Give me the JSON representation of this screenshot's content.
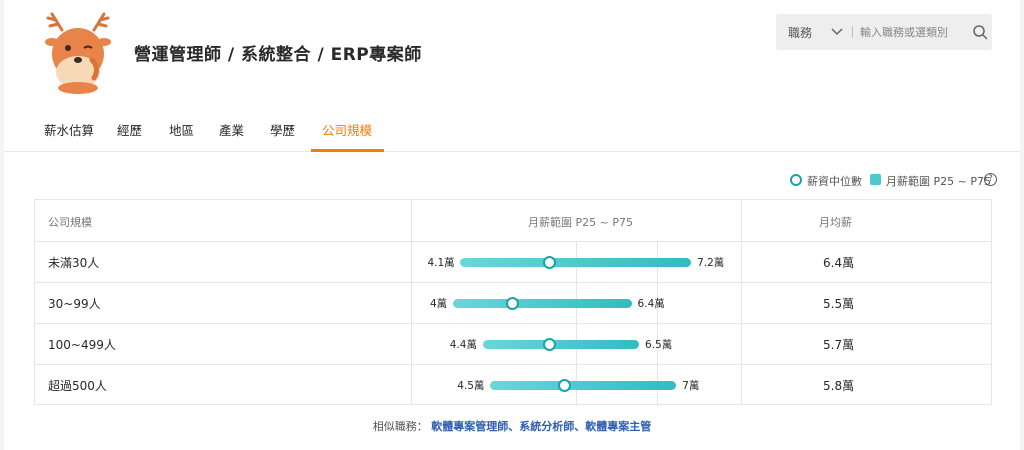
{
  "header": {
    "title": "營運管理師 / 系統整合 / ERP專案師"
  },
  "search": {
    "type_label": "職務",
    "placeholder": "輸入職務或選類別"
  },
  "tabs": [
    {
      "label": "薪水估算",
      "active": false
    },
    {
      "label": "經歷",
      "active": false
    },
    {
      "label": "地區",
      "active": false
    },
    {
      "label": "產業",
      "active": false
    },
    {
      "label": "學歷",
      "active": false
    },
    {
      "label": "公司規模",
      "active": true
    }
  ],
  "legend": {
    "median_label": "薪資中位數",
    "range_label": "月薪範圍 P25 ~ P75",
    "help": "?"
  },
  "table": {
    "headers": [
      "公司規模",
      "月薪範圍 P25 ~ P75",
      "月均薪"
    ],
    "rows": [
      {
        "label": "未滿30人",
        "low": 4.1,
        "high": 7.2,
        "median": 5.3,
        "low_text": "4.1萬",
        "high_text": "7.2萬",
        "avg": "6.4萬"
      },
      {
        "label": "30~99人",
        "low": 4.0,
        "high": 6.4,
        "median": 4.8,
        "low_text": "4萬",
        "high_text": "6.4萬",
        "avg": "5.5萬"
      },
      {
        "label": "100~499人",
        "low": 4.4,
        "high": 6.5,
        "median": 5.3,
        "low_text": "4.4萬",
        "high_text": "6.5萬",
        "avg": "5.7萬"
      },
      {
        "label": "超過500人",
        "low": 4.5,
        "high": 7.0,
        "median": 5.5,
        "low_text": "4.5萬",
        "high_text": "7萬",
        "avg": "5.8萬"
      }
    ]
  },
  "similar": {
    "label": "相似職務：",
    "jobs": "軟體專案管理師、系統分析師、軟體專案主管"
  },
  "colors": {
    "accent": "#ff7800",
    "bar": "#4dc9cd",
    "median_ring": "#1aa3a9",
    "link": "#2f5fb3"
  }
}
